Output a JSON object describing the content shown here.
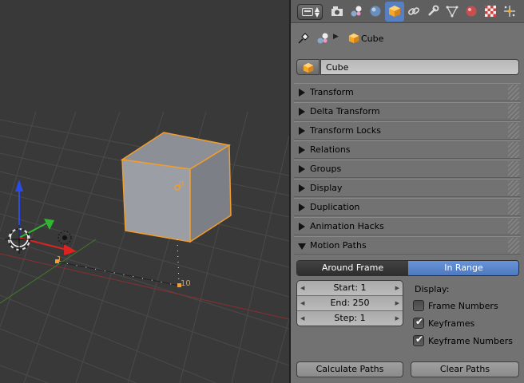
{
  "viewport": {
    "object_origin_label": "0",
    "path_start_label": "1",
    "path_end_label": "10"
  },
  "properties": {
    "context_tabs": [
      {
        "icon": "render-icon",
        "active": false
      },
      {
        "icon": "render-layers-icon",
        "active": false
      },
      {
        "icon": "scene-icon",
        "active": false
      },
      {
        "icon": "world-icon",
        "active": false
      },
      {
        "icon": "object-icon",
        "active": true
      },
      {
        "icon": "constraints-icon",
        "active": false
      },
      {
        "icon": "modifiers-icon",
        "active": false
      },
      {
        "icon": "data-icon",
        "active": false
      },
      {
        "icon": "material-icon",
        "active": false
      },
      {
        "icon": "texture-icon",
        "active": false
      },
      {
        "icon": "physics-icon",
        "active": false
      }
    ],
    "breadcrumb": {
      "object": "Cube"
    },
    "object_name": "Cube",
    "panels": [
      {
        "label": "Transform",
        "open": false
      },
      {
        "label": "Delta Transform",
        "open": false
      },
      {
        "label": "Transform Locks",
        "open": false
      },
      {
        "label": "Relations",
        "open": false
      },
      {
        "label": "Groups",
        "open": false
      },
      {
        "label": "Display",
        "open": false
      },
      {
        "label": "Duplication",
        "open": false
      },
      {
        "label": "Animation Hacks",
        "open": false
      },
      {
        "label": "Motion Paths",
        "open": true
      }
    ],
    "motion_paths": {
      "range_modes": [
        "Around Frame",
        "In Range"
      ],
      "selected_mode": "In Range",
      "start": "Start: 1",
      "end": "End: 250",
      "step": "Step: 1",
      "display_label": "Display:",
      "options": [
        {
          "label": "Frame Numbers",
          "checked": false
        },
        {
          "label": "Keyframes",
          "checked": true
        },
        {
          "label": "Keyframe Numbers",
          "checked": true
        }
      ],
      "calculate_label": "Calculate Paths",
      "clear_label": "Clear Paths"
    },
    "colors": {
      "active_tab": "#5680c2",
      "selected_outline": "#f29d2c",
      "panel_bg": "#727272"
    }
  }
}
